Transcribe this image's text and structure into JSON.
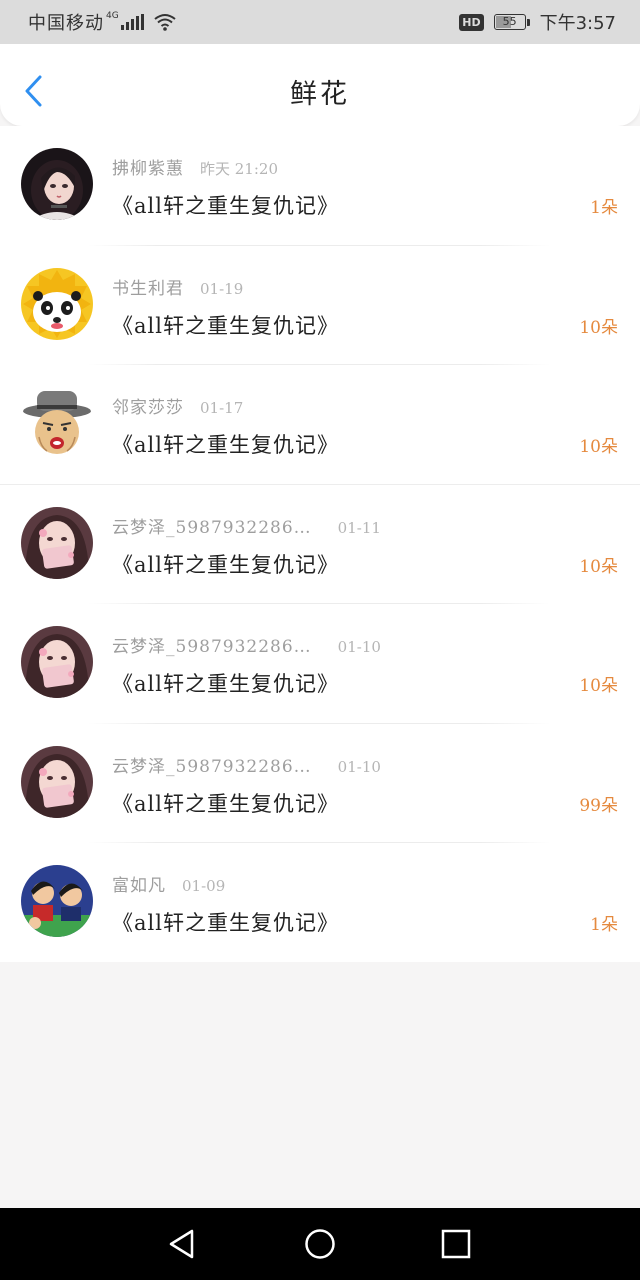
{
  "status_bar": {
    "carrier": "中国移动",
    "network": "4G",
    "battery": "55",
    "battery_level": 0.55,
    "time": "下午3:57",
    "hd_label": "HD"
  },
  "header": {
    "title": "鲜花",
    "accent_color": "#2f8ff0"
  },
  "entries": [
    {
      "user": "拂柳紫蕙",
      "date": "昨天  21:20",
      "book": "《all轩之重生复仇记》",
      "count": "1朵",
      "avatar": "anime-girl-dark"
    },
    {
      "user": "书生利君",
      "date": "01-19",
      "book": "《all轩之重生复仇记》",
      "count": "10朵",
      "avatar": "panda-sun"
    },
    {
      "user": "邻家莎莎",
      "date": "01-17",
      "book": "《all轩之重生复仇记》",
      "count": "10朵",
      "avatar": "old-man-hat"
    },
    {
      "user": "云梦泽_5987932286…",
      "date": "01-11",
      "book": "《all轩之重生复仇记》",
      "count": "10朵",
      "avatar": "girl-pink"
    },
    {
      "user": "云梦泽_5987932286…",
      "date": "01-10",
      "book": "《all轩之重生复仇记》",
      "count": "10朵",
      "avatar": "girl-pink"
    },
    {
      "user": "云梦泽_5987932286…",
      "date": "01-10",
      "book": "《all轩之重生复仇记》",
      "count": "99朵",
      "avatar": "girl-pink"
    },
    {
      "user": "富如凡",
      "date": "01-09",
      "book": "《all轩之重生复仇记》",
      "count": "1朵",
      "avatar": "cartoon-group"
    }
  ],
  "colors": {
    "count": "#e58a3f",
    "username": "#9e9e9e",
    "title_text": "#222222",
    "background": "#f6f5f5"
  }
}
